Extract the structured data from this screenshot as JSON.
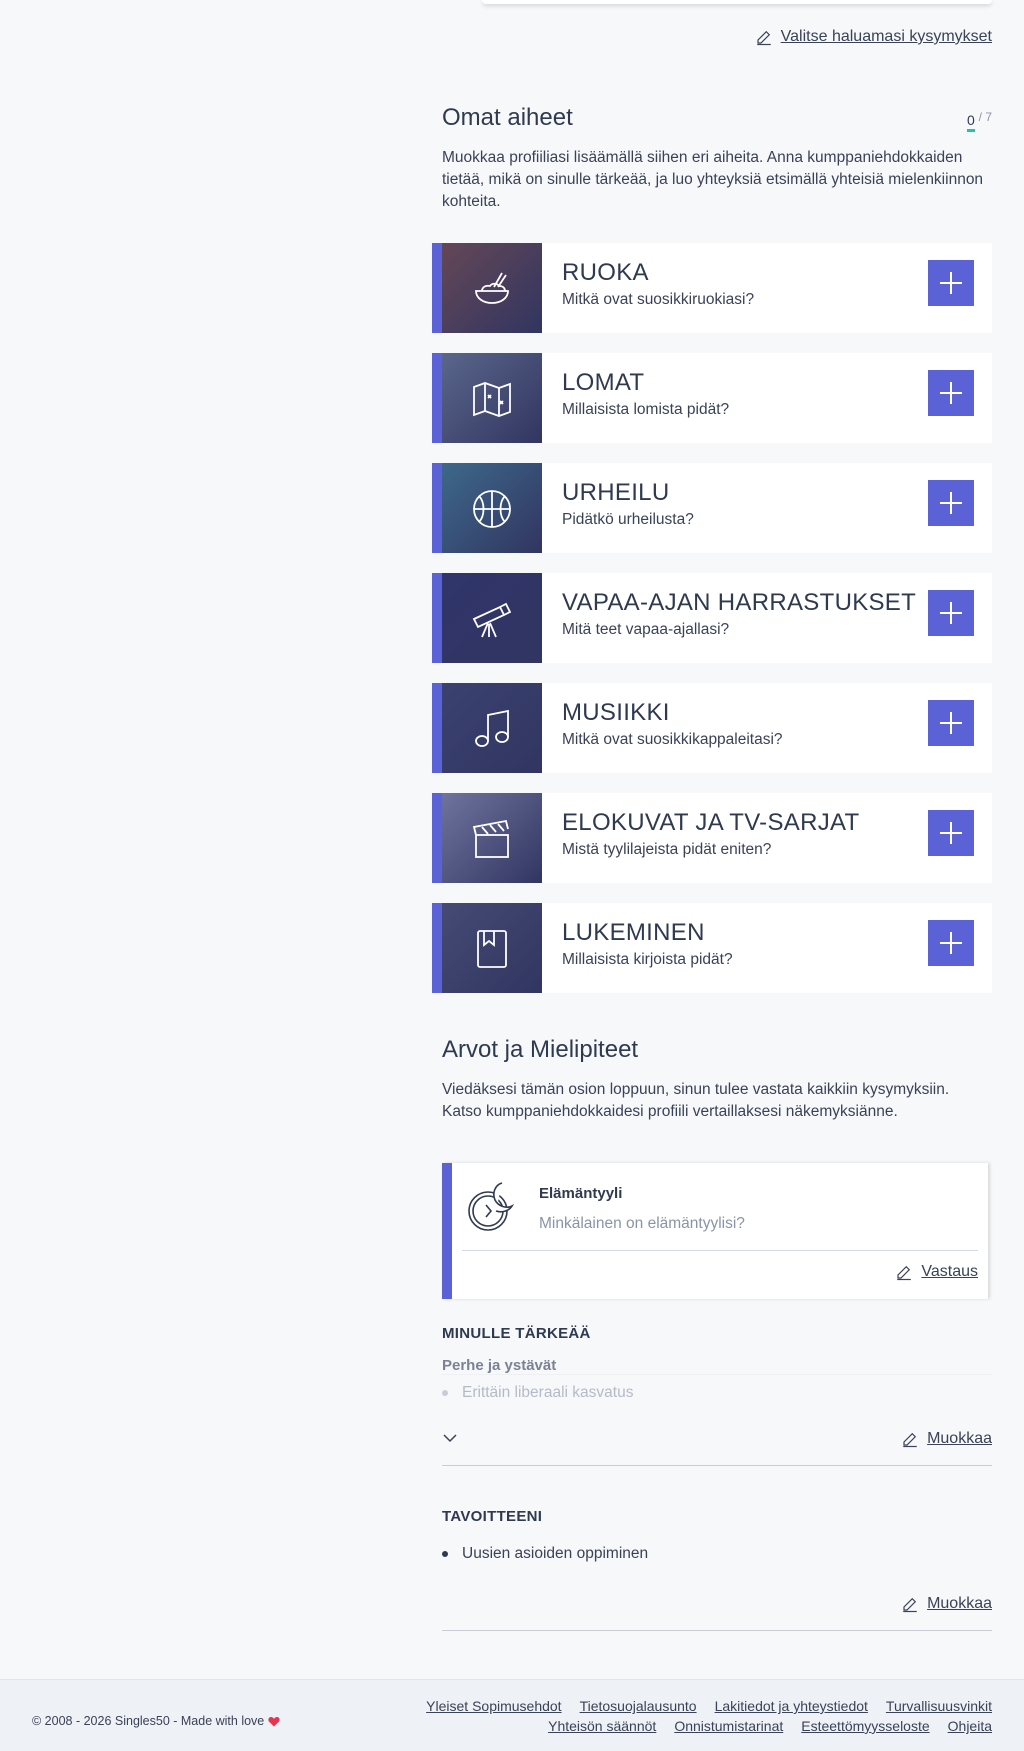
{
  "top": {
    "select_questions": "Valitse haluamasi kysymykset"
  },
  "topics_section": {
    "title": "Omat aiheet",
    "counter_current": "0",
    "counter_total": "/ 7",
    "description": "Muokkaa profiiliasi lisäämällä siihen eri aiheita. Anna kumppaniehdokkaiden tietää, mikä on sinulle tärkeää, ja luo yhteyksiä etsimällä yhteisiä mielenkiinnon kohteita.",
    "items": [
      {
        "title": "RUOKA",
        "subtitle": "Mitkä ovat suosikkiruokiasi?",
        "icon": "food-icon",
        "color": "#7a4a3a"
      },
      {
        "title": "LOMAT",
        "subtitle": "Millaisista lomista pidät?",
        "icon": "map-icon",
        "color": "#6b7a8a"
      },
      {
        "title": "URHEILU",
        "subtitle": "Pidätkö urheilusta?",
        "icon": "basketball-icon",
        "color": "#3f7d8a"
      },
      {
        "title": "VAPAA-AJAN HARRASTUKSET",
        "subtitle": "Mitä teet vapaa-ajallasi?",
        "icon": "telescope-icon",
        "color": "#2a2f5a"
      },
      {
        "title": "MUSIIKKI",
        "subtitle": "Mitkä ovat suosikkikappaleitasi?",
        "icon": "music-note-icon",
        "color": "#3b4262"
      },
      {
        "title": "ELOKUVAT JA TV-SARJAT",
        "subtitle": "Mistä tyylilajeista pidät eniten?",
        "icon": "clapperboard-icon",
        "color": "#8a8fa8"
      },
      {
        "title": "LUKEMINEN",
        "subtitle": "Millaisista kirjoista pidät?",
        "icon": "book-icon",
        "color": "#4a5068"
      }
    ]
  },
  "values_section": {
    "title": "Arvot ja Mielipiteet",
    "description": "Viedäksesi tämän osion loppuun, sinun tulee vastata kaikkiin kysymyksiin. Katso kumppaniehdokkaidesi profiili vertaillaksesi näkemyksiänne.",
    "question": {
      "title": "Elämäntyyli",
      "subtitle": "Minkälainen on elämäntyylisi?",
      "answer_label": "Vastaus"
    },
    "important": {
      "heading": "MINULLE TÄRKEÄÄ",
      "subheading": "Perhe ja ystävät",
      "items": [
        "Erittäin liberaali kasvatus"
      ],
      "edit_label": "Muokkaa"
    },
    "goals": {
      "heading": "TAVOITTEENI",
      "items": [
        "Uusien asioiden oppiminen"
      ],
      "edit_label": "Muokkaa"
    }
  },
  "footer": {
    "copyright": "© 2008 - 2026 Singles50 - Made with love",
    "links_row1": [
      "Yleiset Sopimusehdot",
      "Tietosuojalausunto",
      "Lakitiedot ja yhteystiedot",
      "Turvallisuusvinkit"
    ],
    "links_row2": [
      "Yhteisön säännöt",
      "Onnistumistarinat",
      "Esteettömyysseloste",
      "Ohjeita"
    ],
    "accent": "#e8344e"
  },
  "colors": {
    "primary": "#5a62d6",
    "teal": "#1ec8a4",
    "text": "#3a4256",
    "background": "#f6f8fa"
  }
}
